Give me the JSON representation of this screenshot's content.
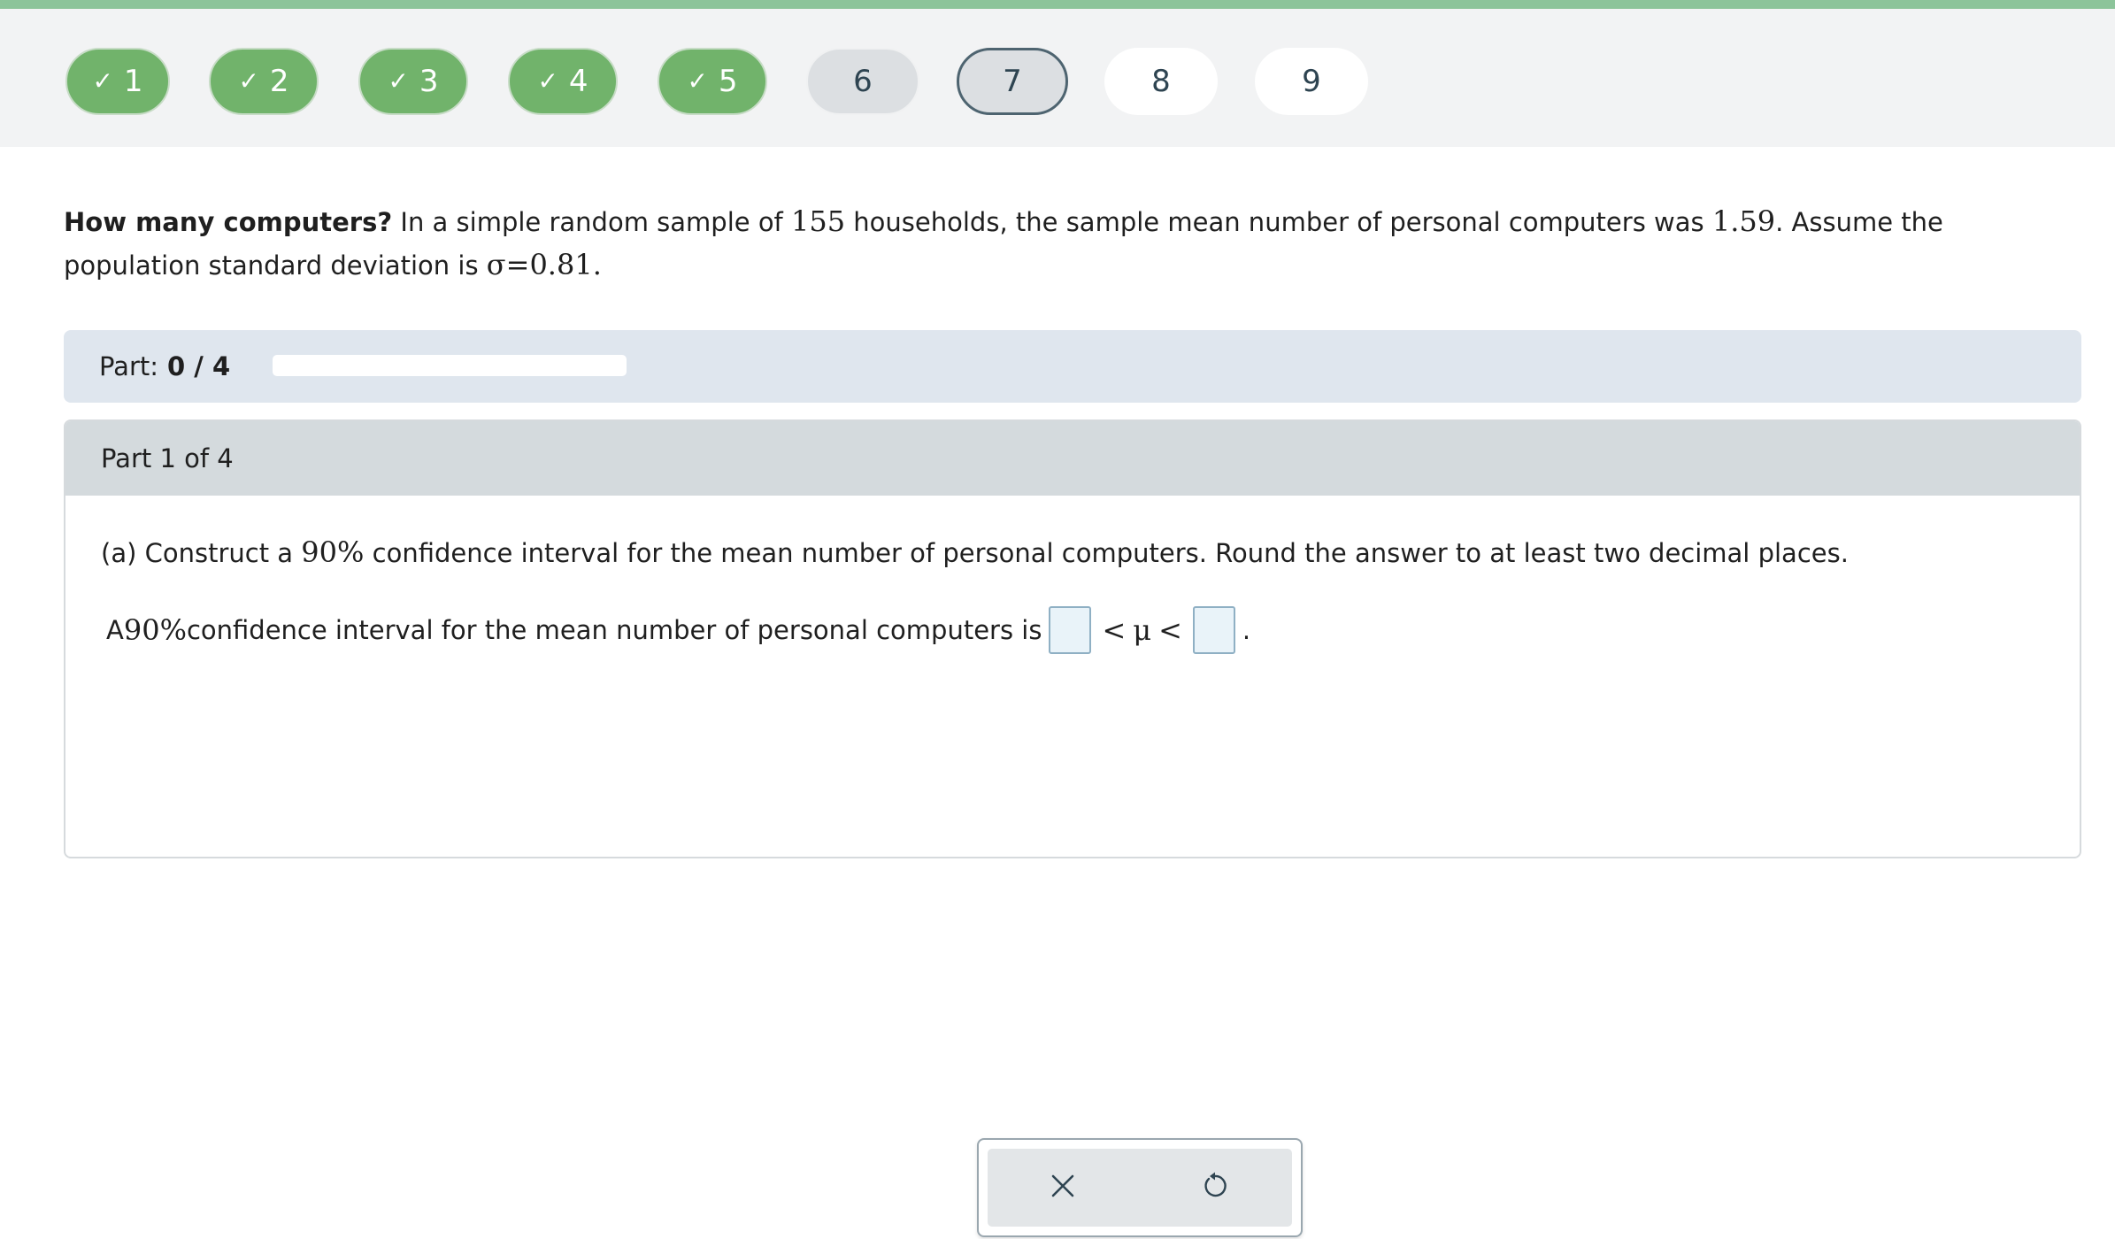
{
  "nav": {
    "items": [
      {
        "label": "1",
        "status": "complete"
      },
      {
        "label": "2",
        "status": "complete"
      },
      {
        "label": "3",
        "status": "complete"
      },
      {
        "label": "4",
        "status": "complete"
      },
      {
        "label": "5",
        "status": "complete"
      },
      {
        "label": "6",
        "status": "visited"
      },
      {
        "label": "7",
        "status": "current"
      },
      {
        "label": "8",
        "status": "unvisited"
      },
      {
        "label": "9",
        "status": "unvisited"
      }
    ],
    "check_icon": "checkmark-icon"
  },
  "problem": {
    "title": "How many computers?",
    "t1": " In a simple random sample of ",
    "n": "155",
    "t2": " households, the sample mean number of personal computers was ",
    "mean": "1.59",
    "t3": ". Assume the population standard deviation is ",
    "sigma": "σ=0.81",
    "t4": "."
  },
  "progress": {
    "label": "Part:",
    "value": "0 / 4",
    "fraction": 0.0
  },
  "part": {
    "header": "Part 1 of 4",
    "q_prefix": "(a) Construct a ",
    "q_percent": "90%",
    "q_suffix": " confidence interval for the mean number of personal computers. Round the answer to at least two decimal places.",
    "a_prefix": "A ",
    "a_percent": "90%",
    "a_text": " confidence interval for the mean number of personal computers is ",
    "rel1": "<",
    "mu": "μ",
    "rel2": "<",
    "end": "."
  },
  "tools": {
    "clear_icon": "close-icon",
    "undo_icon": "undo-icon"
  },
  "colors": {
    "complete": "#71b36b",
    "accent_bar": "#8cc49a",
    "answer_box": "#e9f3f9"
  }
}
